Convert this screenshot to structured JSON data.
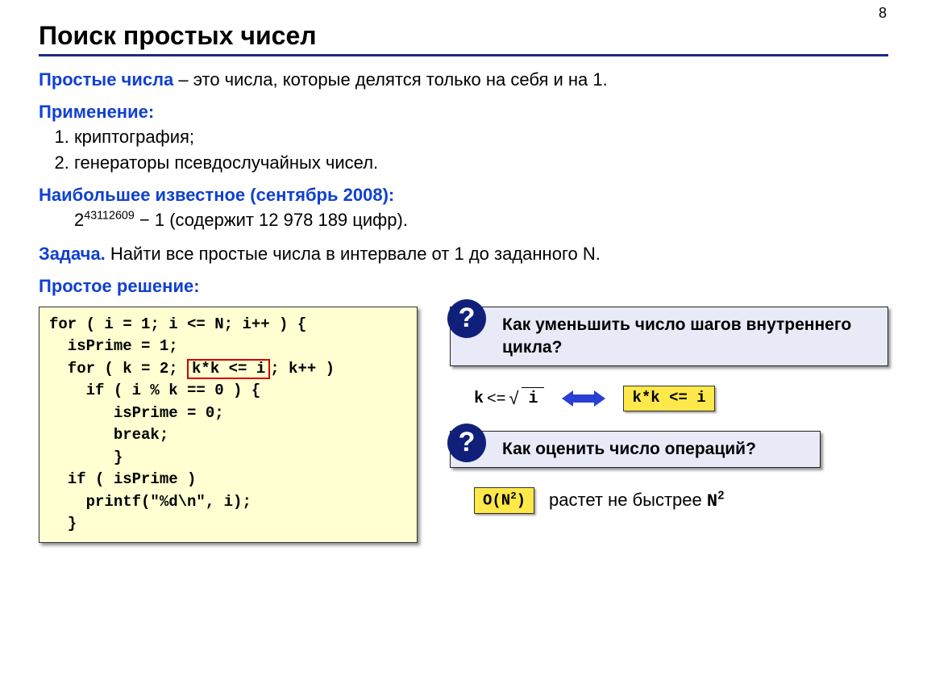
{
  "pageNumber": "8",
  "title": "Поиск простых чисел",
  "definition": {
    "term": "Простые числа",
    "text": " – это числа, которые делятся только на себя и на 1."
  },
  "applications": {
    "heading": "Применение:",
    "items": [
      "криптография;",
      "генераторы псевдослучайных чисел."
    ]
  },
  "largestKnown": {
    "heading": "Наибольшее известное (сентябрь 2008):",
    "base": "2",
    "exponent": "43112609",
    "tail": " − 1 (содержит 12 978 189 цифр)."
  },
  "task": {
    "label": "Задача.",
    "text": " Найти все простые числа в интервале от 1 до заданного N."
  },
  "simpleSolution": {
    "heading": "Простое решение:"
  },
  "code": {
    "line1": "for ( i = 1; i <= N; i++ ) {",
    "line2": "  isPrime = 1;",
    "line3a": "  for ( k = 2; ",
    "line3b": "k*k <= i",
    "line3c": "; k++ )",
    "line4": "    if ( i % k == 0 ) {",
    "line5": "       isPrime = 0;",
    "line6": "       break;",
    "line7": "       }",
    "line8": "  if ( isPrime )",
    "line9": "    printf(\"%d\\n\", i);",
    "line10": "  }"
  },
  "question1": "Как уменьшить число шагов внутреннего цикла?",
  "equivalence": {
    "lhs_k": "k",
    "lhs_op": " <= ",
    "lhs_radicand": "i",
    "rhs": "k*k <= i"
  },
  "question2": "Как оценить число операций?",
  "complexity": {
    "bigO_prefix": "O(N",
    "bigO_exp": "2",
    "bigO_suffix": ")",
    "text_prefix": "растет не быстрее ",
    "N_base": "N",
    "N_exp": "2"
  }
}
